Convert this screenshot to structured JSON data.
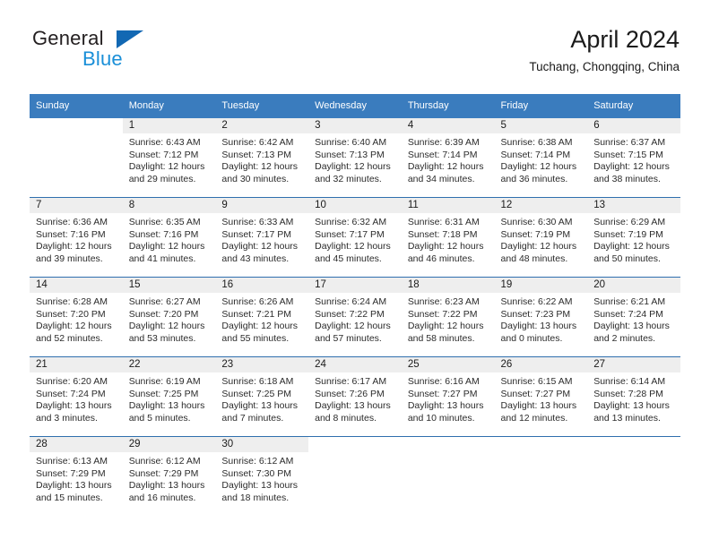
{
  "brand": {
    "name_part1": "General",
    "name_part2": "Blue",
    "logo_icon": "triangle-logo-icon",
    "accent_color": "#1268b3",
    "secondary_color": "#1a8fd8"
  },
  "header": {
    "title": "April 2024",
    "subtitle": "Tuchang, Chongqing, China"
  },
  "calendar": {
    "header_bg": "#3a7cbe",
    "daynum_bg": "#eeeeee",
    "week_border_color": "#2f6fae",
    "weekday_labels": [
      "Sunday",
      "Monday",
      "Tuesday",
      "Wednesday",
      "Thursday",
      "Friday",
      "Saturday"
    ],
    "weeks": [
      [
        {
          "day": "",
          "sunrise": "",
          "sunset": "",
          "daylight_line1": "",
          "daylight_line2": ""
        },
        {
          "day": "1",
          "sunrise": "Sunrise: 6:43 AM",
          "sunset": "Sunset: 7:12 PM",
          "daylight_line1": "Daylight: 12 hours",
          "daylight_line2": "and 29 minutes."
        },
        {
          "day": "2",
          "sunrise": "Sunrise: 6:42 AM",
          "sunset": "Sunset: 7:13 PM",
          "daylight_line1": "Daylight: 12 hours",
          "daylight_line2": "and 30 minutes."
        },
        {
          "day": "3",
          "sunrise": "Sunrise: 6:40 AM",
          "sunset": "Sunset: 7:13 PM",
          "daylight_line1": "Daylight: 12 hours",
          "daylight_line2": "and 32 minutes."
        },
        {
          "day": "4",
          "sunrise": "Sunrise: 6:39 AM",
          "sunset": "Sunset: 7:14 PM",
          "daylight_line1": "Daylight: 12 hours",
          "daylight_line2": "and 34 minutes."
        },
        {
          "day": "5",
          "sunrise": "Sunrise: 6:38 AM",
          "sunset": "Sunset: 7:14 PM",
          "daylight_line1": "Daylight: 12 hours",
          "daylight_line2": "and 36 minutes."
        },
        {
          "day": "6",
          "sunrise": "Sunrise: 6:37 AM",
          "sunset": "Sunset: 7:15 PM",
          "daylight_line1": "Daylight: 12 hours",
          "daylight_line2": "and 38 minutes."
        }
      ],
      [
        {
          "day": "7",
          "sunrise": "Sunrise: 6:36 AM",
          "sunset": "Sunset: 7:16 PM",
          "daylight_line1": "Daylight: 12 hours",
          "daylight_line2": "and 39 minutes."
        },
        {
          "day": "8",
          "sunrise": "Sunrise: 6:35 AM",
          "sunset": "Sunset: 7:16 PM",
          "daylight_line1": "Daylight: 12 hours",
          "daylight_line2": "and 41 minutes."
        },
        {
          "day": "9",
          "sunrise": "Sunrise: 6:33 AM",
          "sunset": "Sunset: 7:17 PM",
          "daylight_line1": "Daylight: 12 hours",
          "daylight_line2": "and 43 minutes."
        },
        {
          "day": "10",
          "sunrise": "Sunrise: 6:32 AM",
          "sunset": "Sunset: 7:17 PM",
          "daylight_line1": "Daylight: 12 hours",
          "daylight_line2": "and 45 minutes."
        },
        {
          "day": "11",
          "sunrise": "Sunrise: 6:31 AM",
          "sunset": "Sunset: 7:18 PM",
          "daylight_line1": "Daylight: 12 hours",
          "daylight_line2": "and 46 minutes."
        },
        {
          "day": "12",
          "sunrise": "Sunrise: 6:30 AM",
          "sunset": "Sunset: 7:19 PM",
          "daylight_line1": "Daylight: 12 hours",
          "daylight_line2": "and 48 minutes."
        },
        {
          "day": "13",
          "sunrise": "Sunrise: 6:29 AM",
          "sunset": "Sunset: 7:19 PM",
          "daylight_line1": "Daylight: 12 hours",
          "daylight_line2": "and 50 minutes."
        }
      ],
      [
        {
          "day": "14",
          "sunrise": "Sunrise: 6:28 AM",
          "sunset": "Sunset: 7:20 PM",
          "daylight_line1": "Daylight: 12 hours",
          "daylight_line2": "and 52 minutes."
        },
        {
          "day": "15",
          "sunrise": "Sunrise: 6:27 AM",
          "sunset": "Sunset: 7:20 PM",
          "daylight_line1": "Daylight: 12 hours",
          "daylight_line2": "and 53 minutes."
        },
        {
          "day": "16",
          "sunrise": "Sunrise: 6:26 AM",
          "sunset": "Sunset: 7:21 PM",
          "daylight_line1": "Daylight: 12 hours",
          "daylight_line2": "and 55 minutes."
        },
        {
          "day": "17",
          "sunrise": "Sunrise: 6:24 AM",
          "sunset": "Sunset: 7:22 PM",
          "daylight_line1": "Daylight: 12 hours",
          "daylight_line2": "and 57 minutes."
        },
        {
          "day": "18",
          "sunrise": "Sunrise: 6:23 AM",
          "sunset": "Sunset: 7:22 PM",
          "daylight_line1": "Daylight: 12 hours",
          "daylight_line2": "and 58 minutes."
        },
        {
          "day": "19",
          "sunrise": "Sunrise: 6:22 AM",
          "sunset": "Sunset: 7:23 PM",
          "daylight_line1": "Daylight: 13 hours",
          "daylight_line2": "and 0 minutes."
        },
        {
          "day": "20",
          "sunrise": "Sunrise: 6:21 AM",
          "sunset": "Sunset: 7:24 PM",
          "daylight_line1": "Daylight: 13 hours",
          "daylight_line2": "and 2 minutes."
        }
      ],
      [
        {
          "day": "21",
          "sunrise": "Sunrise: 6:20 AM",
          "sunset": "Sunset: 7:24 PM",
          "daylight_line1": "Daylight: 13 hours",
          "daylight_line2": "and 3 minutes."
        },
        {
          "day": "22",
          "sunrise": "Sunrise: 6:19 AM",
          "sunset": "Sunset: 7:25 PM",
          "daylight_line1": "Daylight: 13 hours",
          "daylight_line2": "and 5 minutes."
        },
        {
          "day": "23",
          "sunrise": "Sunrise: 6:18 AM",
          "sunset": "Sunset: 7:25 PM",
          "daylight_line1": "Daylight: 13 hours",
          "daylight_line2": "and 7 minutes."
        },
        {
          "day": "24",
          "sunrise": "Sunrise: 6:17 AM",
          "sunset": "Sunset: 7:26 PM",
          "daylight_line1": "Daylight: 13 hours",
          "daylight_line2": "and 8 minutes."
        },
        {
          "day": "25",
          "sunrise": "Sunrise: 6:16 AM",
          "sunset": "Sunset: 7:27 PM",
          "daylight_line1": "Daylight: 13 hours",
          "daylight_line2": "and 10 minutes."
        },
        {
          "day": "26",
          "sunrise": "Sunrise: 6:15 AM",
          "sunset": "Sunset: 7:27 PM",
          "daylight_line1": "Daylight: 13 hours",
          "daylight_line2": "and 12 minutes."
        },
        {
          "day": "27",
          "sunrise": "Sunrise: 6:14 AM",
          "sunset": "Sunset: 7:28 PM",
          "daylight_line1": "Daylight: 13 hours",
          "daylight_line2": "and 13 minutes."
        }
      ],
      [
        {
          "day": "28",
          "sunrise": "Sunrise: 6:13 AM",
          "sunset": "Sunset: 7:29 PM",
          "daylight_line1": "Daylight: 13 hours",
          "daylight_line2": "and 15 minutes."
        },
        {
          "day": "29",
          "sunrise": "Sunrise: 6:12 AM",
          "sunset": "Sunset: 7:29 PM",
          "daylight_line1": "Daylight: 13 hours",
          "daylight_line2": "and 16 minutes."
        },
        {
          "day": "30",
          "sunrise": "Sunrise: 6:12 AM",
          "sunset": "Sunset: 7:30 PM",
          "daylight_line1": "Daylight: 13 hours",
          "daylight_line2": "and 18 minutes."
        },
        {
          "day": "",
          "sunrise": "",
          "sunset": "",
          "daylight_line1": "",
          "daylight_line2": ""
        },
        {
          "day": "",
          "sunrise": "",
          "sunset": "",
          "daylight_line1": "",
          "daylight_line2": ""
        },
        {
          "day": "",
          "sunrise": "",
          "sunset": "",
          "daylight_line1": "",
          "daylight_line2": ""
        },
        {
          "day": "",
          "sunrise": "",
          "sunset": "",
          "daylight_line1": "",
          "daylight_line2": ""
        }
      ]
    ]
  }
}
